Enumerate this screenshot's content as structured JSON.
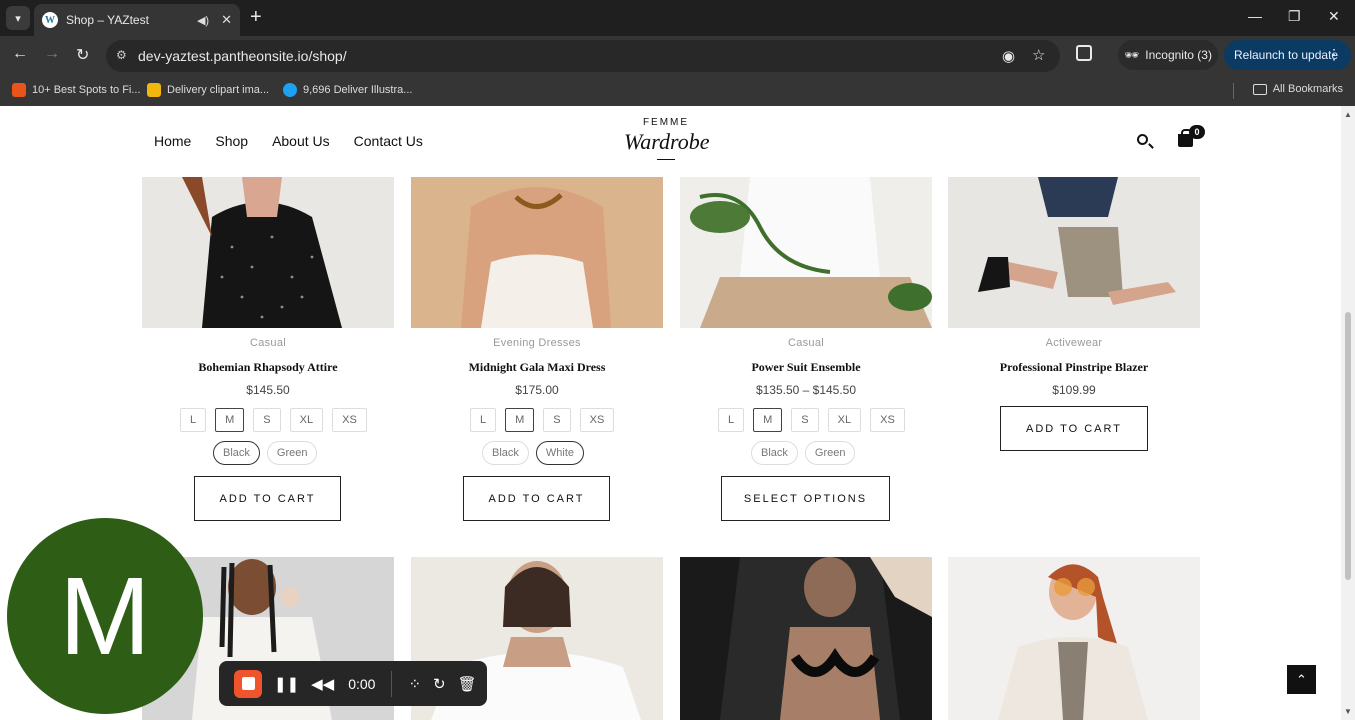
{
  "browser": {
    "tab_title": "Shop – YAZtest",
    "url": "dev-yaztest.pantheonsite.io/shop/",
    "incognito_label": "Incognito (3)",
    "relaunch_label": "Relaunch to update",
    "bookmarks": [
      {
        "label": "10+ Best Spots to Fi...",
        "color": "#e8541a"
      },
      {
        "label": "Delivery clipart ima...",
        "color": "#f1b70c"
      },
      {
        "label": "9,696 Deliver Illustra...",
        "color": "#1da1f2"
      }
    ],
    "all_bookmarks": "All Bookmarks"
  },
  "site": {
    "nav": [
      "Home",
      "Shop",
      "About Us",
      "Contact Us"
    ],
    "logo_top": "FEMME",
    "logo_main": "Wardrobe",
    "cart_count": "0"
  },
  "products": [
    {
      "category": "Casual",
      "name": "Bohemian Rhapsody Attire",
      "price": "$145.50",
      "sizes": [
        "L",
        "M",
        "S",
        "XL",
        "XS"
      ],
      "selected_size": "M",
      "colors": [
        "Black",
        "Green"
      ],
      "selected_color": "Black",
      "button": "ADD TO CART"
    },
    {
      "category": "Evening Dresses",
      "name": "Midnight Gala Maxi Dress",
      "price": "$175.00",
      "sizes": [
        "L",
        "M",
        "S",
        "XS"
      ],
      "selected_size": "M",
      "colors": [
        "Black",
        "White"
      ],
      "selected_color": "White",
      "button": "ADD TO CART"
    },
    {
      "category": "Casual",
      "name": "Power Suit Ensemble",
      "price": "$135.50 – $145.50",
      "sizes": [
        "L",
        "M",
        "S",
        "XL",
        "XS"
      ],
      "selected_size": "M",
      "colors": [
        "Black",
        "Green"
      ],
      "selected_color": "",
      "button": "SELECT OPTIONS"
    },
    {
      "category": "Activewear",
      "name": "Professional Pinstripe Blazer",
      "price": "$109.99",
      "sizes": [],
      "selected_size": "",
      "colors": [],
      "selected_color": "",
      "button": "ADD TO CART"
    }
  ],
  "recorder": {
    "avatar_letter": "M",
    "time": "0:00",
    "accent": "#f0542d"
  }
}
